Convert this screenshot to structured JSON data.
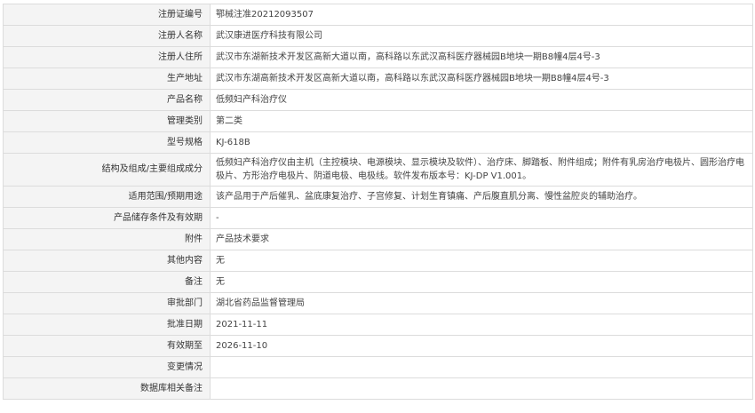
{
  "record": {
    "rows": [
      {
        "label": "注册证编号",
        "value": "鄂械注准20212093507"
      },
      {
        "label": "注册人名称",
        "value": "武汉康进医疗科技有限公司"
      },
      {
        "label": "注册人住所",
        "value": "武汉市东湖新技术开发区高新大道以南，高科路以东武汉高科医疗器械园B地块一期B8幢4层4号-3"
      },
      {
        "label": "生产地址",
        "value": "武汉市东湖高新技术开发区高新大道以南，高科路以东武汉高科医疗器械园B地块一期B8幢4层4号-3"
      },
      {
        "label": "产品名称",
        "value": "低频妇产科治疗仪"
      },
      {
        "label": "管理类别",
        "value": "第二类"
      },
      {
        "label": "型号规格",
        "value": "KJ-618B"
      },
      {
        "label": "结构及组成/主要组成成分",
        "value": "低频妇产科治疗仪由主机（主控模块、电源模块、显示模块及软件）、治疗床、脚踏板、附件组成；附件有乳房治疗电极片、圆形治疗电极片、方形治疗电极片、阴道电极、电极线。软件发布版本号：KJ-DP V1.001。"
      },
      {
        "label": "适用范围/预期用途",
        "value": "该产品用于产后催乳、盆底康复治疗、子宫修复、计划生育镇痛、产后腹直肌分离、慢性盆腔炎的辅助治疗。"
      },
      {
        "label": "产品储存条件及有效期",
        "value": "-"
      },
      {
        "label": "附件",
        "value": "产品技术要求"
      },
      {
        "label": "其他内容",
        "value": "无"
      },
      {
        "label": "备注",
        "value": "无"
      },
      {
        "label": "审批部门",
        "value": "湖北省药品监督管理局"
      },
      {
        "label": "批准日期",
        "value": "2021-11-11"
      },
      {
        "label": "有效期至",
        "value": "2026-11-10"
      },
      {
        "label": "变更情况",
        "value": ""
      },
      {
        "label": "数据库相关备注",
        "value": ""
      }
    ]
  }
}
